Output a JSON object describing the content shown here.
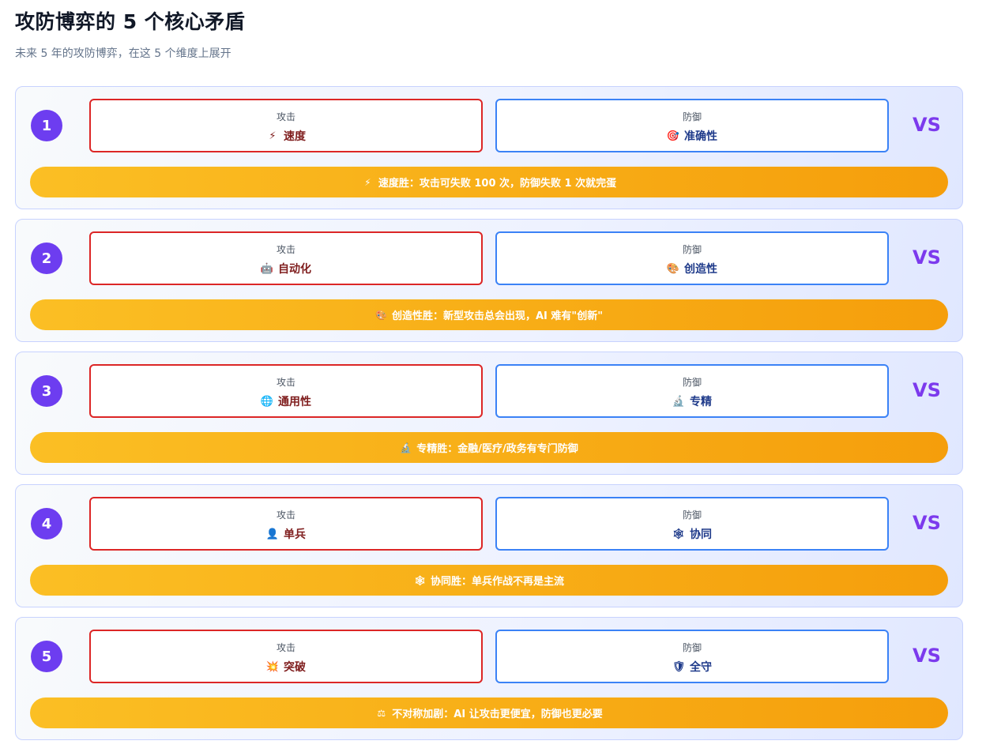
{
  "header": {
    "title": "攻防博弈的 5 个核心矛盾",
    "subtitle": "未来 5 年的攻防博弈，在这 5 个维度上展开"
  },
  "labels": {
    "attack": "攻击",
    "defense": "防御",
    "vs": "VS"
  },
  "rows": [
    {
      "number": "1",
      "attack": {
        "icon": "lightning-icon",
        "glyph": "⚡",
        "text": "速度"
      },
      "defense": {
        "icon": "target-icon",
        "glyph": "🎯",
        "text": "准确性"
      },
      "banner": {
        "icon": "lightning-icon",
        "glyph": "⚡",
        "text": "速度胜：攻击可失败 100 次，防御失败 1 次就完蛋"
      }
    },
    {
      "number": "2",
      "attack": {
        "icon": "robot-icon",
        "glyph": "🤖",
        "text": "自动化"
      },
      "defense": {
        "icon": "palette-icon",
        "glyph": "🎨",
        "text": "创造性"
      },
      "banner": {
        "icon": "palette-icon",
        "glyph": "🎨",
        "text": "创造性胜：新型攻击总会出现，AI 难有\"创新\""
      }
    },
    {
      "number": "3",
      "attack": {
        "icon": "globe-icon",
        "glyph": "🌐",
        "text": "通用性"
      },
      "defense": {
        "icon": "microscope-icon",
        "glyph": "🔬",
        "text": "专精"
      },
      "banner": {
        "icon": "microscope-icon",
        "glyph": "🔬",
        "text": "专精胜：金融/医疗/政务有专门防御"
      }
    },
    {
      "number": "4",
      "attack": {
        "icon": "person-icon",
        "glyph": "👤",
        "text": "单兵"
      },
      "defense": {
        "icon": "network-icon",
        "glyph": "🕸",
        "text": "协同"
      },
      "banner": {
        "icon": "network-icon",
        "glyph": "🕸",
        "text": "协同胜：单兵作战不再是主流"
      }
    },
    {
      "number": "5",
      "attack": {
        "icon": "explosion-icon",
        "glyph": "💥",
        "text": "突破"
      },
      "defense": {
        "icon": "shield-icon",
        "glyph": "🛡",
        "text": "全守"
      },
      "banner": {
        "icon": "scales-icon",
        "glyph": "⚖",
        "text": "不对称加剧：AI 让攻击更便宜，防御也更必要"
      }
    }
  ],
  "colors": {
    "number_badge": "#6d3df0",
    "attack_border": "#dc2626",
    "defense_border": "#3b82f6",
    "vs_text": "#7c3aed",
    "banner_start": "#fbbf24",
    "banner_end": "#f59e0b"
  }
}
